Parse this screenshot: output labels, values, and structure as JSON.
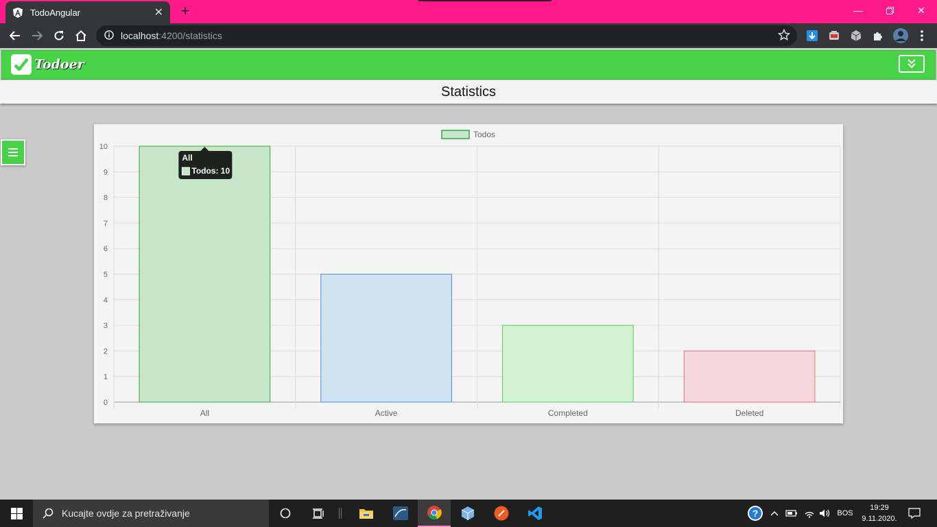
{
  "browser": {
    "tab_title": "TodoAngular",
    "new_tab": "+",
    "url_host": "localhost",
    "url_path": ":4200/statistics"
  },
  "app": {
    "logo_text": "Todoer",
    "page_title": "Statistics",
    "accent_color": "#46d348"
  },
  "chart_data": {
    "type": "bar",
    "categories": [
      "All",
      "Active",
      "Completed",
      "Deleted"
    ],
    "series": [
      {
        "name": "Todos",
        "values": [
          10,
          5,
          3,
          2
        ]
      }
    ],
    "bar_fill_colors": [
      "#c6e5c9",
      "#cfe3f2",
      "#d3f1d3",
      "#f5d7dd"
    ],
    "bar_border_colors": [
      "#34a844",
      "#4a90d9",
      "#5ac95a",
      "#e36b85"
    ],
    "ylim": [
      0,
      10
    ],
    "yticks": [
      0,
      1,
      2,
      3,
      4,
      5,
      6,
      7,
      8,
      9,
      10
    ],
    "grid": true,
    "legend": "top-center",
    "tooltip": {
      "title": "All",
      "label": "Todos: 10"
    }
  },
  "taskbar": {
    "search_placeholder": "Kucajte ovdje za pretraživanje",
    "language": "BOS",
    "time": "19:29",
    "date": "9.11.2020."
  }
}
